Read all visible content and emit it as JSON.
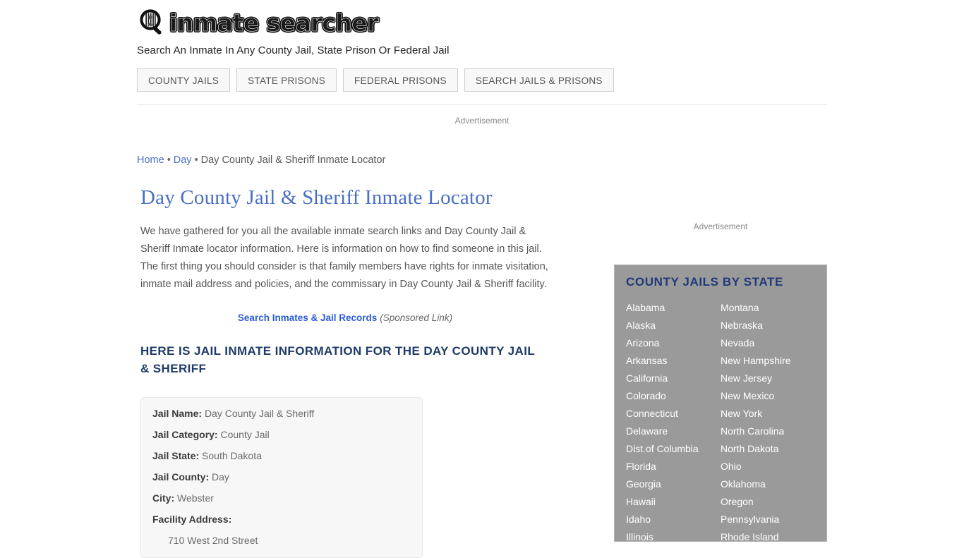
{
  "site": {
    "logo_text": "inmate searcher",
    "logo_icon": "magnifier-prison-bars-icon",
    "tagline": "Search An Inmate In Any County Jail, State Prison Or Federal Jail"
  },
  "nav": {
    "items": [
      {
        "label": "COUNTY JAILS"
      },
      {
        "label": "STATE PRISONS"
      },
      {
        "label": "FEDERAL PRISONS"
      },
      {
        "label": "SEARCH JAILS & PRISONS"
      }
    ]
  },
  "ads": {
    "top_label": "Advertisement",
    "side_label": "Advertisement"
  },
  "breadcrumb": {
    "home": "Home",
    "county": "Day",
    "current": "Day County Jail & Sheriff Inmate Locator",
    "separator": "•"
  },
  "main": {
    "title": "Day County Jail & Sheriff Inmate Locator",
    "intro": "We have gathered for you all the available inmate search links and Day County Jail & Sheriff Inmate locator information. Here is information on how to find someone in this jail. The first thing you should consider is that family members have rights for inmate visitation, inmate mail address and policies, and the commissary in Day County Jail & Sheriff facility.",
    "sponsored_link": "Search Inmates & Jail Records",
    "sponsored_note": "(Sponsored Link)",
    "section_title": "HERE IS JAIL INMATE INFORMATION FOR THE DAY COUNTY JAIL & SHERIFF"
  },
  "info_box": {
    "rows": [
      {
        "label": "Jail Name:",
        "value": "Day County Jail & Sheriff"
      },
      {
        "label": "Jail Category:",
        "value": "County Jail"
      },
      {
        "label": "Jail State:",
        "value": "South Dakota"
      },
      {
        "label": "Jail County:",
        "value": "Day"
      },
      {
        "label": "City:",
        "value": "Webster"
      },
      {
        "label": "Facility Address:",
        "value": ""
      }
    ],
    "address_line": "710 West 2nd Street"
  },
  "sidebar": {
    "heading": "COUNTY JAILS BY STATE",
    "column_left": [
      "Alabama",
      "Alaska",
      "Arizona",
      "Arkansas",
      "California",
      "Colorado",
      "Connecticut",
      "Delaware",
      "Dist.of Columbia",
      "Florida",
      "Georgia",
      "Hawaii",
      "Idaho",
      "Illinois"
    ],
    "column_right": [
      "Montana",
      "Nebraska",
      "Nevada",
      "New Hampshire",
      "New Jersey",
      "New Mexico",
      "New York",
      "North Carolina",
      "North Dakota",
      "Ohio",
      "Oklahoma",
      "Oregon",
      "Pennsylvania",
      "Rhode Island"
    ]
  },
  "colors": {
    "link_blue": "#4a6fc4",
    "heading_navy": "#1f3a68",
    "sidebar_bg": "#9a9a9a",
    "sponsored_blue": "#2a5bd7"
  }
}
